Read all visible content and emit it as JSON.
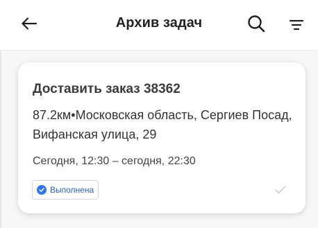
{
  "header": {
    "title": "Архив задач",
    "back_icon": "arrow-left-icon",
    "search_icon": "search-icon",
    "filter_icon": "filter-icon"
  },
  "task": {
    "title": "Доставить заказ 38362",
    "address": "87.2км•Московская область, Сергиев Посад, Вифанская улица, 29",
    "time": "Сегодня, 12:30 – сегодня, 22:30",
    "status": "Выполнена",
    "status_icon": "check-circle-icon",
    "done_icon": "checkmark-icon"
  },
  "colors": {
    "accent": "#2f77e8",
    "badge_text": "#2d62c8",
    "background": "#f7f7f7",
    "card": "#ffffff"
  }
}
